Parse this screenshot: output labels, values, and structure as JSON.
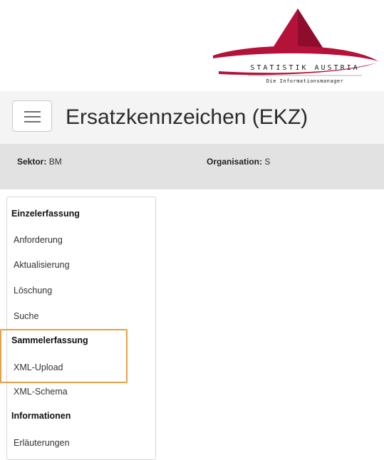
{
  "logo": {
    "name": "STATISTIK AUSTRIA",
    "tagline": "Die Informationsmanager",
    "brand_color": "#b5123a"
  },
  "header": {
    "menu_icon": "hamburger-menu-icon",
    "title": "Ersatzkennzeichen (EKZ)"
  },
  "info": {
    "sektor_label": "Sektor:",
    "sektor_value": "BM",
    "org_label": "Organisation:",
    "org_value": "S"
  },
  "sidebar": {
    "sections": [
      {
        "heading": "Einzelerfassung",
        "items": [
          "Anforderung",
          "Aktualisierung",
          "Löschung",
          "Suche"
        ]
      },
      {
        "heading": "Sammelerfassung",
        "items": [
          "XML-Upload",
          "XML-Schema"
        ]
      },
      {
        "heading": "Informationen",
        "items": [
          "Erläuterungen"
        ]
      }
    ]
  },
  "highlight_color": "#e8a046"
}
